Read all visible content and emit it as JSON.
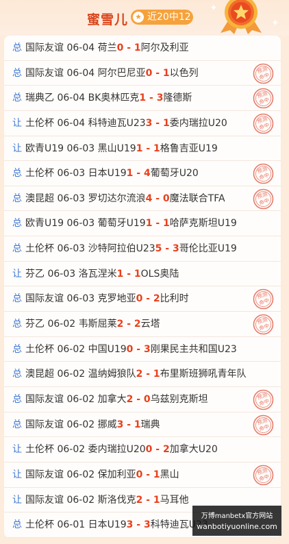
{
  "header": {
    "name": "蜜雪儿",
    "record": "近20中12"
  },
  "stamp_text": [
    "预测",
    "命中"
  ],
  "rows": [
    {
      "type": "总",
      "league": "国际友谊",
      "date": "06-04",
      "home": "荷兰",
      "score": "0 - 1",
      "away": "阿尔及利亚",
      "hit": false
    },
    {
      "type": "总",
      "league": "国际友谊",
      "date": "06-04",
      "home": "阿尔巴尼亚",
      "score": "0 - 1",
      "away": "以色列",
      "hit": true
    },
    {
      "type": "总",
      "league": "瑞典乙",
      "date": "06-04",
      "home": "BK奥林匹克",
      "score": "1 - 3",
      "away": "隆德斯",
      "hit": true
    },
    {
      "type": "让",
      "league": "土伦杯",
      "date": "06-04",
      "home": "科特迪瓦U23",
      "score": "3 - 1",
      "away": "委内瑞拉U20",
      "hit": true
    },
    {
      "type": "让",
      "league": "欧青U19",
      "date": "06-03",
      "home": "黑山U19",
      "score": "1 - 1",
      "away": "格鲁吉亚U19",
      "hit": false
    },
    {
      "type": "总",
      "league": "土伦杯",
      "date": "06-03",
      "home": "日本U19",
      "score": "1 - 4",
      "away": "葡萄牙U20",
      "hit": true
    },
    {
      "type": "总",
      "league": "澳昆超",
      "date": "06-03",
      "home": "罗切达尔流浪",
      "score": "4 - 0",
      "away": "魔法联合TFA",
      "hit": true
    },
    {
      "type": "总",
      "league": "欧青U19",
      "date": "06-03",
      "home": "葡萄牙U19",
      "score": "1 - 1",
      "away": "哈萨克斯坦U19",
      "hit": false
    },
    {
      "type": "总",
      "league": "土伦杯",
      "date": "06-03",
      "home": "沙特阿拉伯U23",
      "score": "5 - 3",
      "away": "哥伦比亚U19",
      "hit": false
    },
    {
      "type": "让",
      "league": "芬乙",
      "date": "06-03",
      "home": "洛瓦涅米",
      "score": "1 - 1",
      "away": "OLS奥陆",
      "hit": false
    },
    {
      "type": "总",
      "league": "国际友谊",
      "date": "06-03",
      "home": "克罗地亚",
      "score": "0 - 2",
      "away": "比利时",
      "hit": true
    },
    {
      "type": "总",
      "league": "芬乙",
      "date": "06-02",
      "home": "韦斯屈莱",
      "score": "2 - 2",
      "away": "云塔",
      "hit": true
    },
    {
      "type": "总",
      "league": "土伦杯",
      "date": "06-02",
      "home": "中国U19",
      "score": "0 - 3",
      "away": "刚果民主共和国U23",
      "hit": false
    },
    {
      "type": "总",
      "league": "澳昆超",
      "date": "06-02",
      "home": "温纳姆狼队",
      "score": "2 - 1",
      "away": "布里斯班狮吼青年队",
      "hit": false
    },
    {
      "type": "总",
      "league": "国际友谊",
      "date": "06-02",
      "home": "加拿大",
      "score": "2 - 0",
      "away": "乌兹别克斯坦",
      "hit": true
    },
    {
      "type": "总",
      "league": "国际友谊",
      "date": "06-02",
      "home": "挪威",
      "score": "3 - 1",
      "away": "瑞典",
      "hit": true
    },
    {
      "type": "让",
      "league": "土伦杯",
      "date": "06-02",
      "home": "委内瑞拉U20",
      "score": "0 - 2",
      "away": "加拿大U20",
      "hit": false
    },
    {
      "type": "让",
      "league": "国际友谊",
      "date": "06-02",
      "home": "保加利亚",
      "score": "0 - 1",
      "away": "黑山",
      "hit": true
    },
    {
      "type": "让",
      "league": "国际友谊",
      "date": "06-02",
      "home": "斯洛伐克",
      "score": "2 - 1",
      "away": "马耳他",
      "hit": false
    },
    {
      "type": "总",
      "league": "土伦杯",
      "date": "06-01",
      "home": "日本U19",
      "score": "3 - 3",
      "away": "科特迪瓦U23",
      "hit": false
    }
  ],
  "watermark": {
    "line1": "万博manbetx官方网站",
    "line2": "wanbotiyuonline.com"
  },
  "colors": {
    "accent": "#e8401c",
    "type_blue": "#3f79d6",
    "badge": "#f6a23b",
    "stamp": "#e67a6a"
  }
}
